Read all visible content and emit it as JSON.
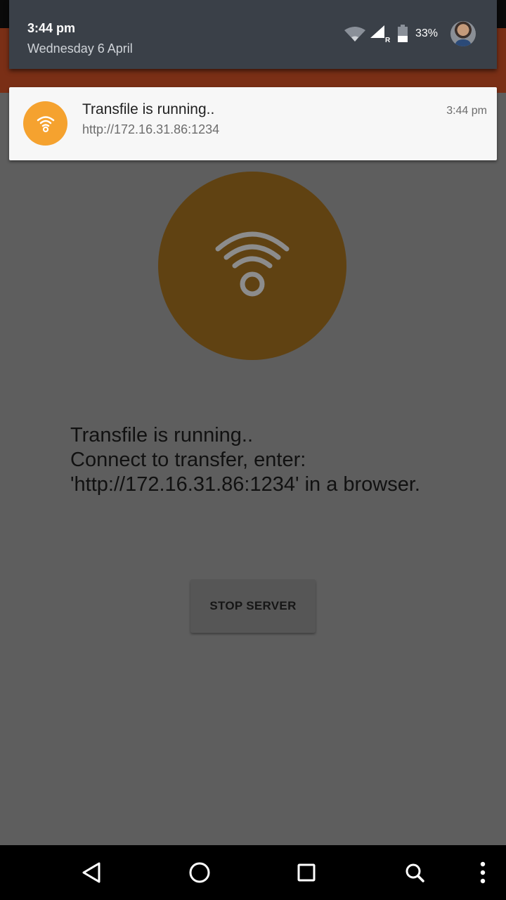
{
  "status_bar": {
    "time": "3:44 pm",
    "date": "Wednesday 6 April",
    "battery_percent": "33%",
    "network_label": "R",
    "icons": [
      "wifi-icon",
      "signal-icon",
      "battery-icon",
      "avatar"
    ]
  },
  "notification": {
    "title": "Transfile is running..",
    "url": "http://172.16.31.86:1234",
    "time": "3:44 pm",
    "icon": "wifi-icon",
    "accent_color": "#f5a22f"
  },
  "main": {
    "icon": "wifi-icon",
    "circle_color": "#604212",
    "message_lines": [
      "Transfile is running..",
      "Connect to transfer, enter:",
      "'http://172.16.31.86:1234' in a browser."
    ],
    "stop_button_label": "STOP SERVER"
  },
  "nav_bar": {
    "icons": [
      "back-icon",
      "home-icon",
      "recents-icon",
      "search-icon",
      "more-icon"
    ]
  }
}
